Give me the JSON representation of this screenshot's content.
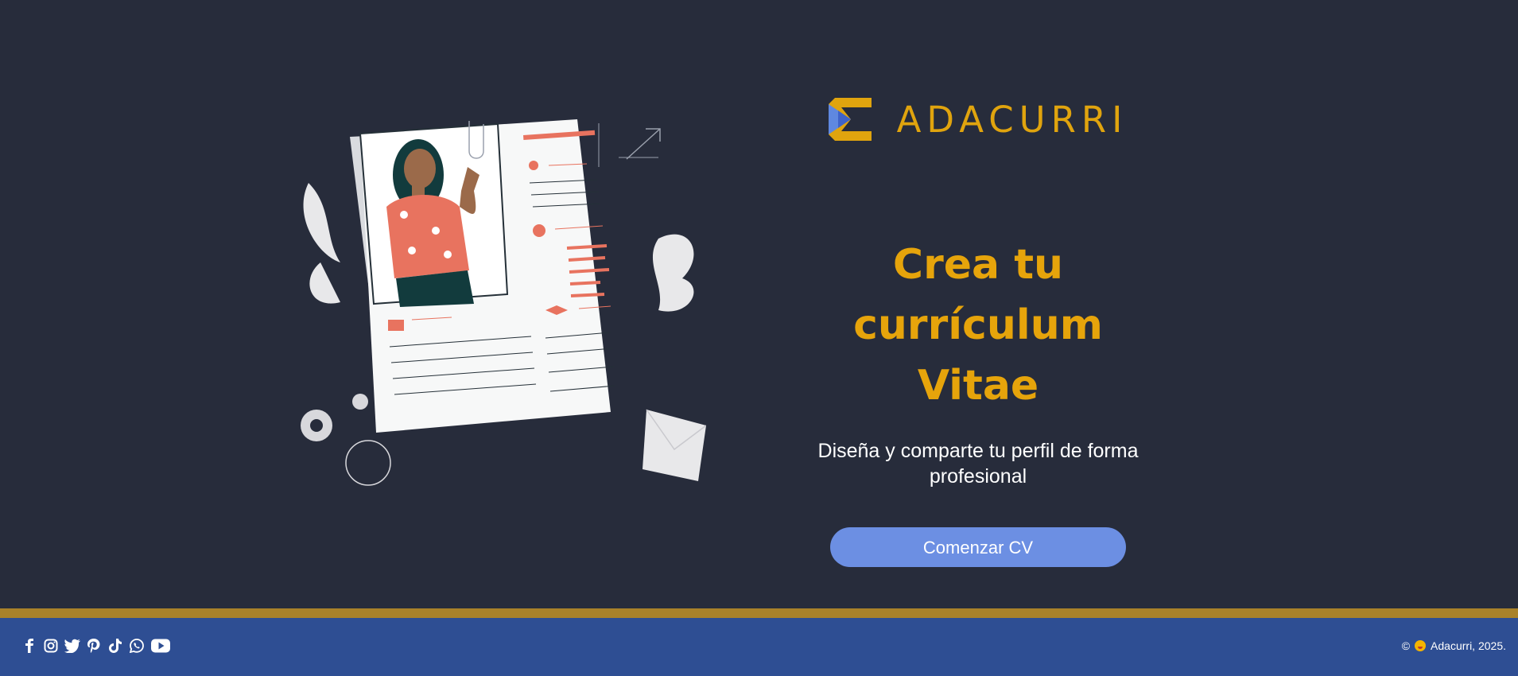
{
  "brand": {
    "name": "ADACURRI"
  },
  "hero": {
    "title_line1": "Crea tu currículum",
    "title_line2": "Vitae",
    "subtitle_line1": "Diseña y comparte tu perfil de forma",
    "subtitle_line2": "profesional",
    "cta_label": "Comenzar CV"
  },
  "footer": {
    "socials": [
      "facebook-icon",
      "instagram-icon",
      "twitter-icon",
      "pinterest-icon",
      "tiktok-icon",
      "whatsapp-icon",
      "youtube-icon"
    ],
    "copyright_symbol": "©",
    "copyright_text": "Adacurri, 2025."
  },
  "colors": {
    "background": "#272c3b",
    "accent_gold": "#e6a40b",
    "cta_blue": "#6c8fe3",
    "footer_blue": "#2e4e93",
    "gold_bar": "#a9822a",
    "resume_accent": "#e8735f"
  }
}
